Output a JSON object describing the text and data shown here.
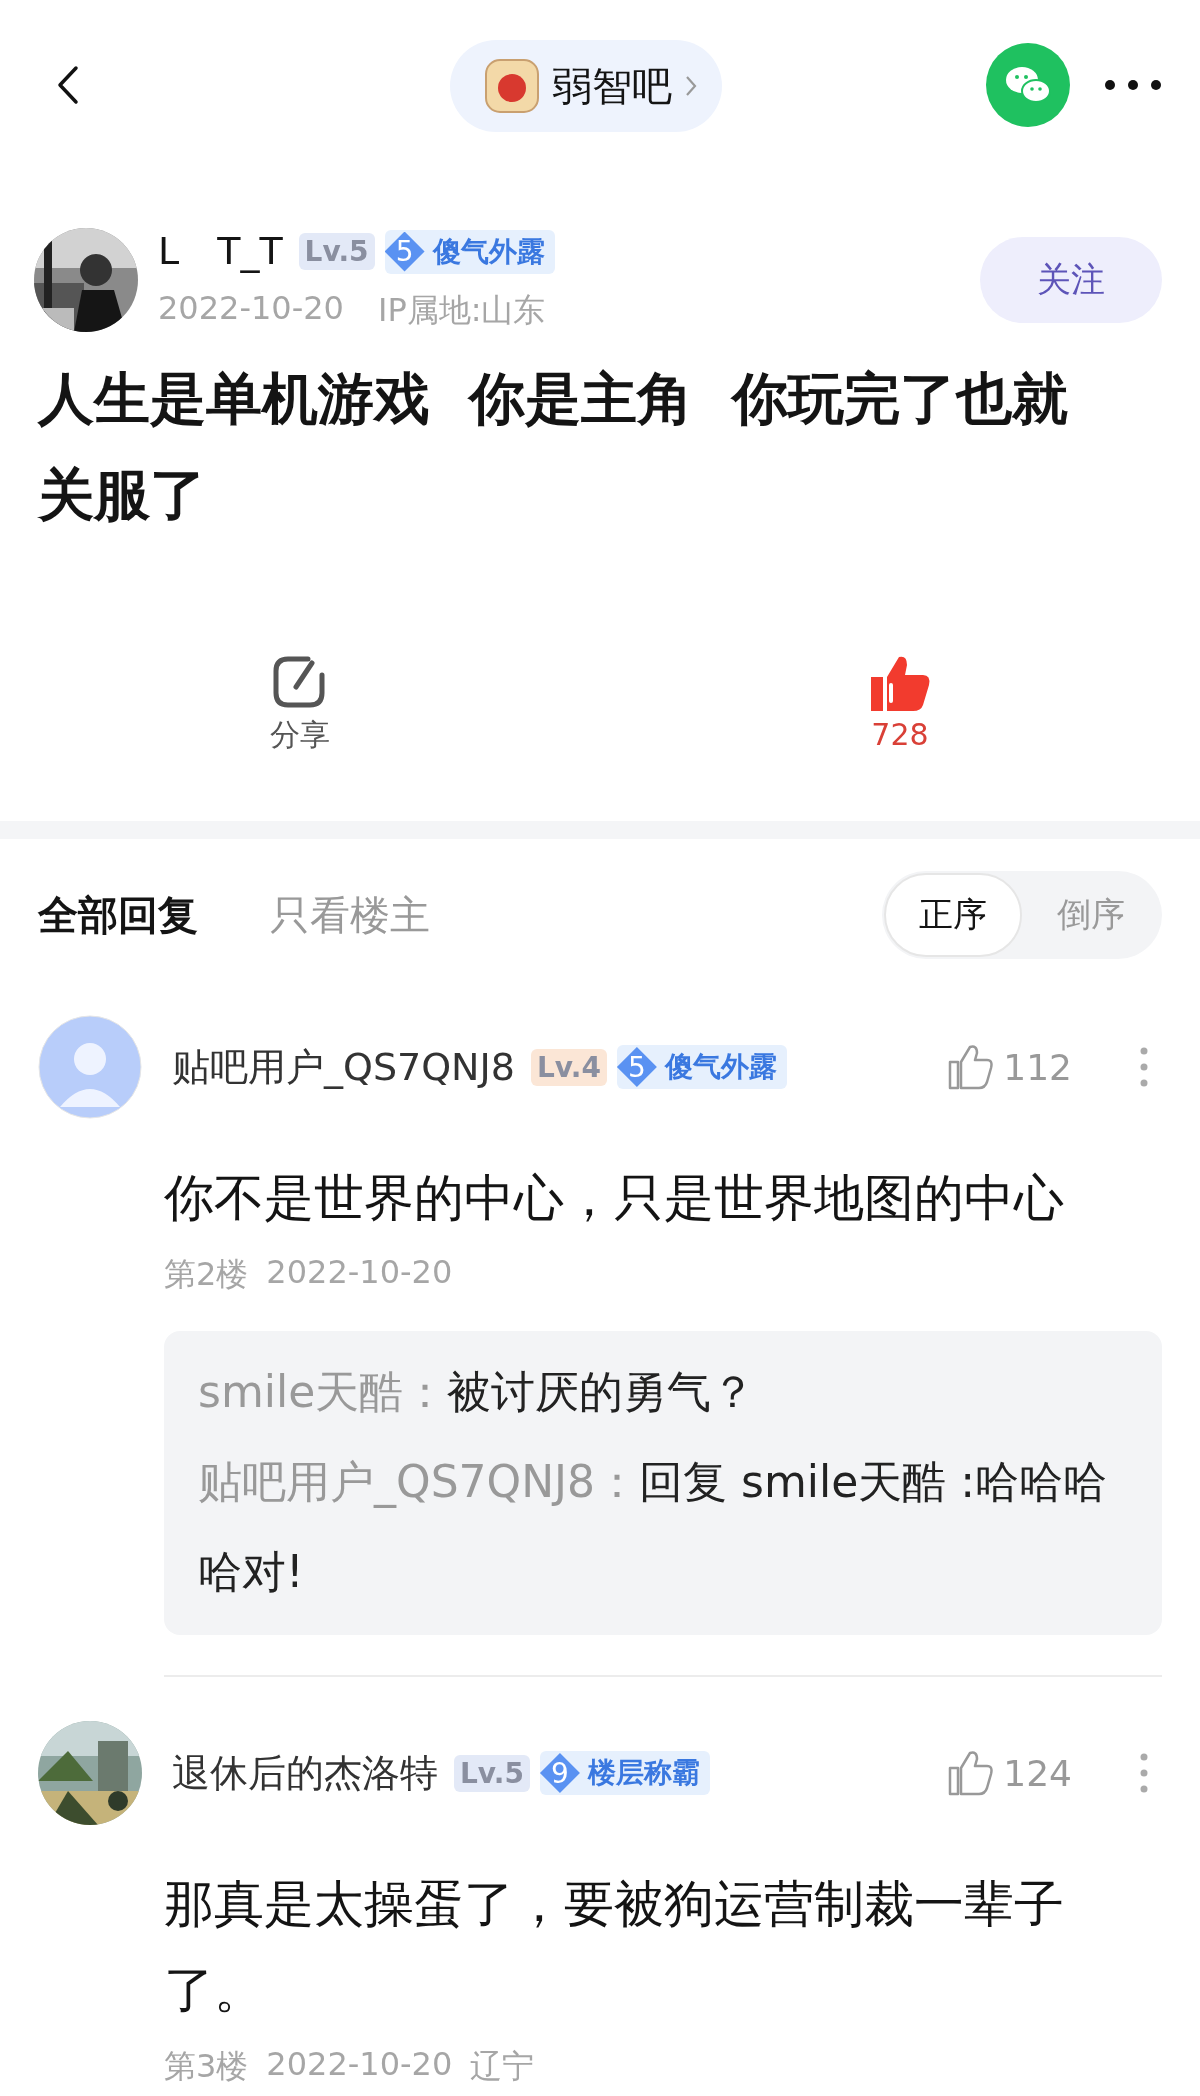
{
  "header": {
    "forum_name": "弱智吧"
  },
  "post": {
    "author": {
      "name": "L　T_T",
      "level": {
        "text": "Lv.5",
        "color": "#e3e9f7"
      },
      "title_number": "5",
      "title": "傻气外露"
    },
    "date": "2022-10-20",
    "ip": "IP属地:山东",
    "follow_label": "关注",
    "title": "人生是单机游戏  你是主角  你玩完了也就关服了"
  },
  "actions": {
    "share_label": "分享",
    "like_count": "728",
    "liked": true
  },
  "reply_tabs": [
    {
      "label": "全部回复",
      "selected": true
    },
    {
      "label": "只看楼主",
      "selected": false
    }
  ],
  "sort": [
    {
      "label": "正序",
      "selected": true
    },
    {
      "label": "倒序",
      "selected": false
    }
  ],
  "comments": [
    {
      "avatar": {
        "kind": "silhouette"
      },
      "name": "贴吧用户_QS7QNJ8",
      "level": {
        "text": "Lv.4",
        "color": "#fbe6d6"
      },
      "title_number": "5",
      "title": "傻气外露",
      "likes": "112",
      "liked": false,
      "text": "你不是世界的中心，只是世界地图的中心",
      "floor": "第2楼",
      "date": "2022-10-20",
      "replies": [
        {
          "author": "smile天酷：",
          "text": "被讨厌的勇气？"
        },
        {
          "author": "贴吧用户_QS7QNJ8：",
          "text": "回复 smile天酷 :哈哈哈哈对!"
        }
      ]
    },
    {
      "name": "退休后的杰洛特",
      "level": {
        "text": "Lv.5",
        "color": "#e3e9f7"
      },
      "title_number": "9",
      "title": "楼层称霸",
      "likes": "124",
      "liked": false,
      "text": "那真是太操蛋了，要被狗运营制裁一辈子了。",
      "floor": "第3楼",
      "date": "2022-10-20",
      "location": "辽宁"
    }
  ]
}
